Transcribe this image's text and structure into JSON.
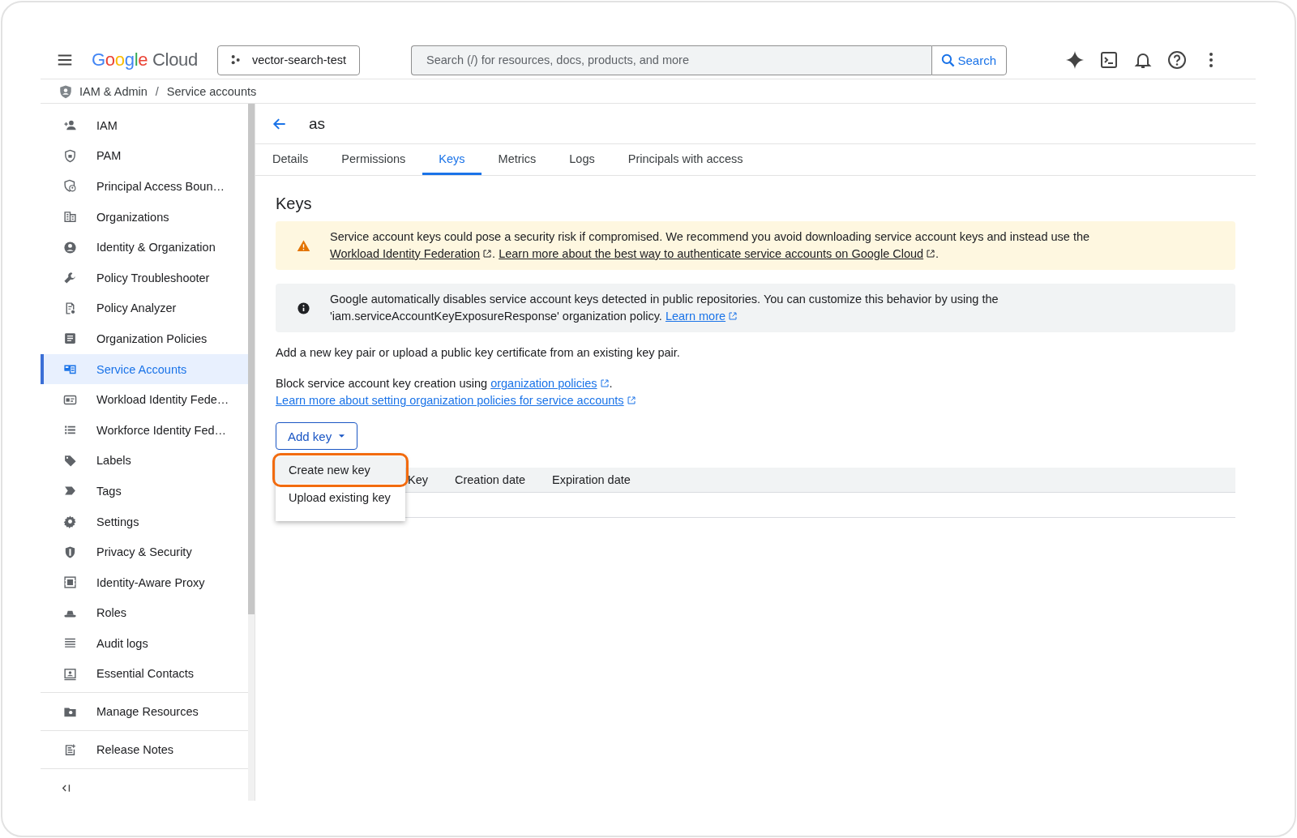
{
  "top_bar": {
    "logo": {
      "brand": "Google",
      "product": "Cloud"
    },
    "project": "vector-search-test",
    "search": {
      "placeholder": "Search (/) for resources, docs, products, and more",
      "button": "Search"
    }
  },
  "breadcrumb": {
    "separator": "/",
    "items": [
      "IAM & Admin",
      "Service accounts"
    ]
  },
  "sidebar": {
    "groups": [
      {
        "items": [
          {
            "label": "IAM",
            "selected": false
          },
          {
            "label": "PAM",
            "selected": false
          },
          {
            "label": "Principal Access Boun…",
            "selected": false
          },
          {
            "label": "Organizations",
            "selected": false
          },
          {
            "label": "Identity & Organization",
            "selected": false
          },
          {
            "label": "Policy Troubleshooter",
            "selected": false
          },
          {
            "label": "Policy Analyzer",
            "selected": false
          },
          {
            "label": "Organization Policies",
            "selected": false
          },
          {
            "label": "Service Accounts",
            "selected": true
          },
          {
            "label": "Workload Identity Fede…",
            "selected": false
          },
          {
            "label": "Workforce Identity Fed…",
            "selected": false
          },
          {
            "label": "Labels",
            "selected": false
          },
          {
            "label": "Tags",
            "selected": false
          },
          {
            "label": "Settings",
            "selected": false
          },
          {
            "label": "Privacy & Security",
            "selected": false
          },
          {
            "label": "Identity-Aware Proxy",
            "selected": false
          },
          {
            "label": "Roles",
            "selected": false
          },
          {
            "label": "Audit logs",
            "selected": false
          },
          {
            "label": "Essential Contacts",
            "selected": false
          }
        ]
      },
      {
        "items": [
          {
            "label": "Manage Resources",
            "selected": false
          }
        ]
      },
      {
        "items": [
          {
            "label": "Release Notes",
            "selected": false
          }
        ]
      }
    ]
  },
  "page": {
    "title": "as",
    "tabs": [
      {
        "label": "Details",
        "selected": false
      },
      {
        "label": "Permissions",
        "selected": false
      },
      {
        "label": "Keys",
        "selected": true
      },
      {
        "label": "Metrics",
        "selected": false
      },
      {
        "label": "Logs",
        "selected": false
      },
      {
        "label": "Principals with access",
        "selected": false
      }
    ],
    "heading": "Keys",
    "banners": [
      {
        "kind": "warning",
        "parts": [
          {
            "kind": "text",
            "text": "Service account keys could pose a security risk if compromised. We recommend you avoid downloading service account keys and instead use the "
          },
          {
            "kind": "link_dark",
            "text": "Workload Identity Federation"
          },
          {
            "kind": "text",
            "text": ". "
          },
          {
            "kind": "link_dark",
            "text": "Learn more about the best way to authenticate service accounts on Google Cloud"
          },
          {
            "kind": "text",
            "text": "."
          }
        ]
      },
      {
        "kind": "info",
        "parts": [
          {
            "kind": "text",
            "text": "Google automatically disables service account keys detected in public repositories. You can customize this behavior by using the 'iam.serviceAccountKeyExposureResponse' organization policy. "
          },
          {
            "kind": "link",
            "text": "Learn more"
          }
        ]
      }
    ],
    "intro": "Add a new key pair or upload a public key certificate from an existing key pair.",
    "policy_note": [
      {
        "kind": "text",
        "text": "Block service account key creation using "
      },
      {
        "kind": "link",
        "text": "organization policies"
      },
      {
        "kind": "text",
        "text": "."
      }
    ],
    "policy_link": "Learn more about setting organization policies for service accounts",
    "add_key": {
      "label": "Add key",
      "menu": [
        {
          "label": "Create new key",
          "highlighted": true
        },
        {
          "label": "Upload existing key",
          "highlighted": false
        }
      ]
    },
    "table": {
      "columns": [
        "Key",
        "Creation date",
        "Expiration date"
      ]
    }
  }
}
